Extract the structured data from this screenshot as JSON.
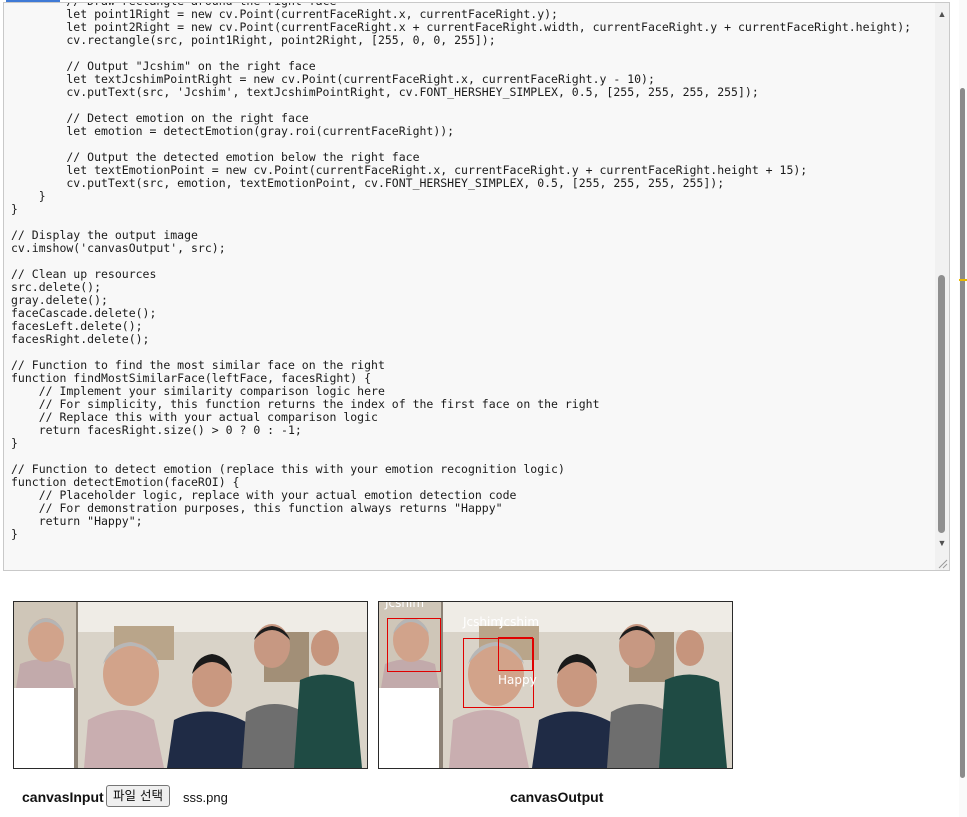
{
  "editor": {
    "code": "        // Draw rectangle around the right face\n        let point1Right = new cv.Point(currentFaceRight.x, currentFaceRight.y);\n        let point2Right = new cv.Point(currentFaceRight.x + currentFaceRight.width, currentFaceRight.y + currentFaceRight.height);\n        cv.rectangle(src, point1Right, point2Right, [255, 0, 0, 255]);\n\n        // Output \"Jcshim\" on the right face\n        let textJcshimPointRight = new cv.Point(currentFaceRight.x, currentFaceRight.y - 10);\n        cv.putText(src, 'Jcshim', textJcshimPointRight, cv.FONT_HERSHEY_SIMPLEX, 0.5, [255, 255, 255, 255]);\n\n        // Detect emotion on the right face\n        let emotion = detectEmotion(gray.roi(currentFaceRight));\n\n        // Output the detected emotion below the right face\n        let textEmotionPoint = new cv.Point(currentFaceRight.x, currentFaceRight.y + currentFaceRight.height + 15);\n        cv.putText(src, emotion, textEmotionPoint, cv.FONT_HERSHEY_SIMPLEX, 0.5, [255, 255, 255, 255]);\n    }\n}\n\n// Display the output image\ncv.imshow('canvasOutput', src);\n\n// Clean up resources\nsrc.delete();\ngray.delete();\nfaceCascade.delete();\nfacesLeft.delete();\nfacesRight.delete();\n\n// Function to find the most similar face on the right\nfunction findMostSimilarFace(leftFace, facesRight) {\n    // Implement your similarity comparison logic here\n    // For simplicity, this function returns the index of the first face on the right\n    // Replace this with your actual comparison logic\n    return facesRight.size() > 0 ? 0 : -1;\n}\n\n// Function to detect emotion (replace this with your emotion recognition logic)\nfunction detectEmotion(faceROI) {\n    // Placeholder logic, replace with your actual emotion detection code\n    // For demonstration purposes, this function always returns \"Happy\"\n    return \"Happy\";\n}",
    "scroll_up_icon": "triangle-up",
    "scroll_down_icon": "triangle-down"
  },
  "input_panel": {
    "caption": "canvasInput",
    "file_button_label": "파일 선택",
    "file_name": "sss.png"
  },
  "output_panel": {
    "caption": "canvasOutput",
    "overlay_texts": [
      "Jcshim",
      "Jcshim",
      "Jcshim",
      "Happy"
    ],
    "rect_color": "#e00000"
  }
}
